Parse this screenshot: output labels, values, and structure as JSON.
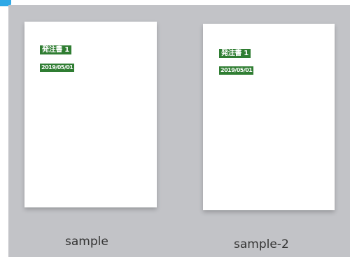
{
  "files": [
    {
      "name": "sample",
      "badge_title": "発注書 1",
      "badge_date": "2019/05/01"
    },
    {
      "name": "sample-2",
      "badge_title": "発注書 1",
      "badge_date": "2019/05/01"
    }
  ],
  "colors": {
    "pane_background": "#c2c3c7",
    "badge_green": "#2f7d32",
    "corner_accent": "#2ea8e6"
  }
}
